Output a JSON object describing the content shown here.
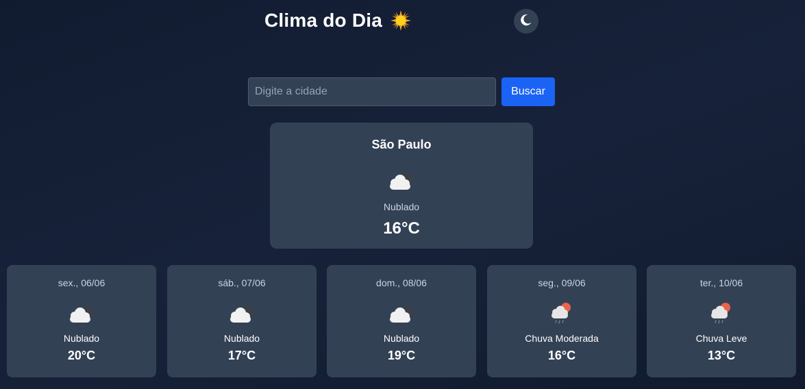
{
  "header": {
    "title": "Clima do Dia",
    "title_icon": "sun-icon",
    "theme_toggle_icon": "moon-icon"
  },
  "search": {
    "placeholder": "Digite a cidade",
    "value": "",
    "button_label": "Buscar"
  },
  "current": {
    "city": "São Paulo",
    "icon": "cloudy-icon",
    "description": "Nublado",
    "temperature": "16°C"
  },
  "forecast": [
    {
      "date": "sex., 06/06",
      "icon": "cloudy-icon",
      "description": "Nublado",
      "temperature": "20°C"
    },
    {
      "date": "sáb., 07/06",
      "icon": "cloudy-icon",
      "description": "Nublado",
      "temperature": "17°C"
    },
    {
      "date": "dom., 08/06",
      "icon": "cloudy-icon",
      "description": "Nublado",
      "temperature": "19°C"
    },
    {
      "date": "seg., 09/06",
      "icon": "sun-rain-icon",
      "description": "Chuva Moderada",
      "temperature": "16°C"
    },
    {
      "date": "ter., 10/06",
      "icon": "sun-rain-icon",
      "description": "Chuva Leve",
      "temperature": "13°C"
    }
  ],
  "colors": {
    "background": "#131d33",
    "card": "#334155",
    "accent": "#1a63f5",
    "sun": "#e8644a"
  }
}
